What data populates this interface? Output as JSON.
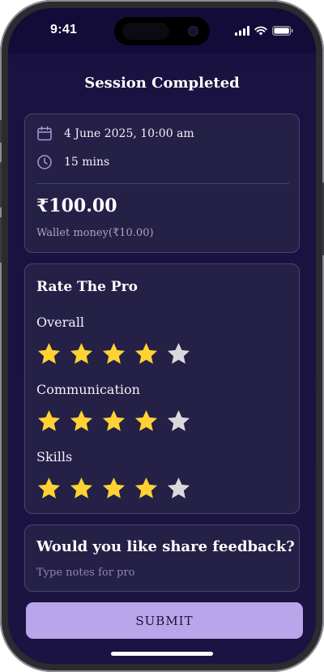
{
  "status_bar": {
    "time": "9:41"
  },
  "header": {
    "title": "Session Completed"
  },
  "session": {
    "date_time": "4 June 2025, 10:00 am",
    "duration": "15 mins",
    "amount": "₹100.00",
    "wallet_note": "Wallet money(₹10.00)"
  },
  "rating": {
    "heading": "Rate The Pro",
    "max_stars": 5,
    "filled_color": "#FFD233",
    "empty_color": "#D9D9DD",
    "categories": [
      {
        "label": "Overall",
        "value": 4
      },
      {
        "label": "Communication",
        "value": 4
      },
      {
        "label": "Skills",
        "value": 4
      }
    ]
  },
  "feedback": {
    "heading": "Would you like share feedback?",
    "placeholder": "Type notes for pro"
  },
  "actions": {
    "submit_label": "SUBMIT"
  },
  "colors": {
    "accent": "#B9A5EA",
    "background": "#1B1442",
    "card": "#252046"
  }
}
